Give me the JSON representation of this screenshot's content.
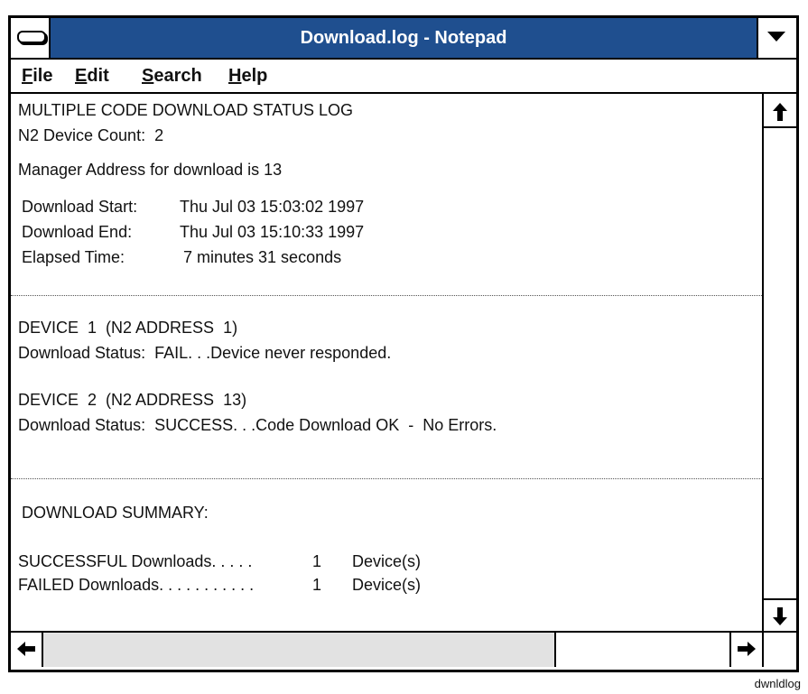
{
  "window": {
    "title": "Download.log - Notepad"
  },
  "menu": [
    {
      "accel": "F",
      "rest": "ile"
    },
    {
      "accel": "E",
      "rest": "dit"
    },
    {
      "accel": "S",
      "rest": "earch"
    },
    {
      "accel": "H",
      "rest": "elp"
    }
  ],
  "log": {
    "header": "MULTIPLE CODE DOWNLOAD STATUS LOG",
    "device_count": "N2 Device Count:  2",
    "manager_address": "Manager Address for download is 13",
    "download_start_label": "Download Start:",
    "download_start_value": "Thu Jul 03 15:03:02 1997",
    "download_end_label": "Download End:",
    "download_end_value": "Thu Jul 03 15:10:33 1997",
    "elapsed_label": "Elapsed Time:",
    "elapsed_value": "7 minutes 31 seconds",
    "device1_title": "DEVICE  1  (N2 ADDRESS  1)",
    "device1_status": "Download Status:  FAIL. . .Device never responded.",
    "device2_title": "DEVICE  2  (N2 ADDRESS  13)",
    "device2_status": "Download Status:  SUCCESS. . .Code Download OK  -  No Errors.",
    "summary_title": "DOWNLOAD SUMMARY:",
    "successful_label": "SUCCESSFUL Downloads. . . . .",
    "successful_count": "1",
    "successful_unit": "Device(s)",
    "failed_label": "FAILED Downloads. . . . . . . . . . .",
    "failed_count": "1",
    "failed_unit": "Device(s)"
  },
  "caption": "dwnldlog",
  "icons": {
    "system_menu": "system-menu-icon",
    "dropdown": "chevron-down-icon",
    "scroll_up": "arrow-up-icon",
    "scroll_down": "arrow-down-icon",
    "scroll_left": "arrow-left-icon",
    "scroll_right": "arrow-right-icon"
  },
  "colors": {
    "title_bar": "#1f4f8f",
    "title_text": "#ffffff",
    "scroll_track": "#e2e2e2"
  }
}
